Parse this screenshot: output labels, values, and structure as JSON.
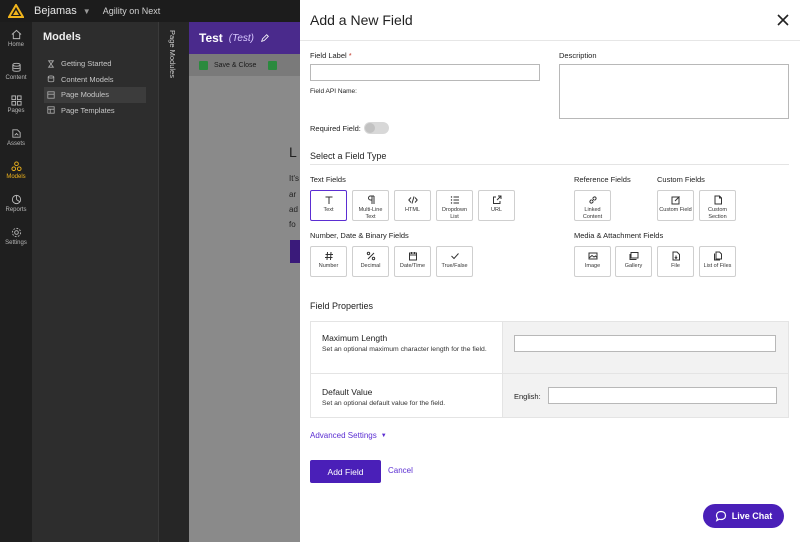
{
  "topbar": {
    "org": "Bejamas",
    "project": "Agility on Next"
  },
  "nav": [
    {
      "label": "Home",
      "icon": "home-icon"
    },
    {
      "label": "Content",
      "icon": "content-icon"
    },
    {
      "label": "Pages",
      "icon": "pages-icon"
    },
    {
      "label": "Assets",
      "icon": "assets-icon"
    },
    {
      "label": "Models",
      "icon": "models-icon",
      "active": true
    },
    {
      "label": "Reports",
      "icon": "reports-icon"
    },
    {
      "label": "Settings",
      "icon": "settings-icon"
    }
  ],
  "models": {
    "title": "Models",
    "items": [
      {
        "label": "Getting Started"
      },
      {
        "label": "Content Models"
      },
      {
        "label": "Page Modules",
        "active": true
      },
      {
        "label": "Page Templates"
      }
    ]
  },
  "strip": {
    "label": "Page Modules"
  },
  "background": {
    "title": "Test",
    "subtitle": "(Test)",
    "save_close": "Save & Close",
    "text_fragments": [
      "L",
      "It's",
      "ar",
      "ad",
      "fo"
    ]
  },
  "modal": {
    "title": "Add a New Field",
    "field_label": "Field Label",
    "required_mark": "*",
    "field_label_value": "",
    "api_name_label": "Field API Name:",
    "description_label": "Description",
    "description_value": "",
    "required_field_label": "Required Field:",
    "required_field_on": false,
    "select_type_title": "Select a Field Type",
    "groups": {
      "text": {
        "title": "Text Fields",
        "items": [
          {
            "label": "Text",
            "icon": "text-icon",
            "selected": true
          },
          {
            "label": "Multi-Line Text",
            "icon": "paragraph-icon"
          },
          {
            "label": "HTML",
            "icon": "code-icon"
          },
          {
            "label": "Dropdown List",
            "icon": "list-icon"
          },
          {
            "label": "URL",
            "icon": "external-link-icon"
          }
        ]
      },
      "reference": {
        "title": "Reference Fields",
        "items": [
          {
            "label": "Linked Content",
            "icon": "link-icon"
          }
        ]
      },
      "custom": {
        "title": "Custom Fields",
        "items": [
          {
            "label": "Custom Field",
            "icon": "edit-icon"
          },
          {
            "label": "Custom Section",
            "icon": "section-icon"
          }
        ]
      },
      "number": {
        "title": "Number, Date & Binary Fields",
        "items": [
          {
            "label": "Number",
            "icon": "hash-icon"
          },
          {
            "label": "Decimal",
            "icon": "percent-icon"
          },
          {
            "label": "Date/Time",
            "icon": "calendar-icon"
          },
          {
            "label": "True/False",
            "icon": "check-icon"
          }
        ]
      },
      "media": {
        "title": "Media & Attachment Fields",
        "items": [
          {
            "label": "Image",
            "icon": "image-icon"
          },
          {
            "label": "Gallery",
            "icon": "gallery-icon"
          },
          {
            "label": "File",
            "icon": "file-icon"
          },
          {
            "label": "List of Files",
            "icon": "files-icon"
          }
        ]
      }
    },
    "properties_title": "Field Properties",
    "properties": {
      "max_length": {
        "title": "Maximum Length",
        "desc": "Set an optional maximum character length for the field.",
        "value": ""
      },
      "default_value": {
        "title": "Default Value",
        "desc": "Set an optional default value for the field.",
        "locale_label": "English:",
        "value": ""
      }
    },
    "advanced_settings": "Advanced Settings",
    "add_button": "Add Field",
    "cancel": "Cancel"
  },
  "live_chat": "Live Chat",
  "colors": {
    "accent": "#4a1fb8",
    "brand_yellow": "#f1b51c"
  }
}
